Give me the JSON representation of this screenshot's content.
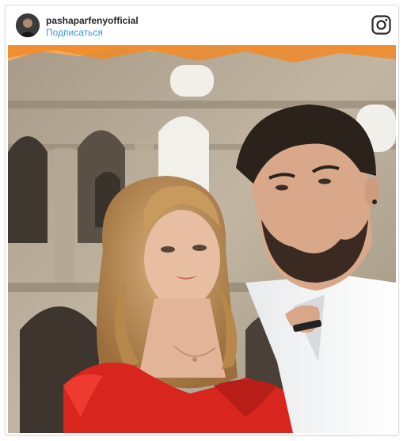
{
  "post": {
    "username": "pashaparfenyofficial",
    "follow_label": "Подписаться"
  },
  "icons": {
    "brand": "instagram-icon",
    "avatar": "avatar"
  },
  "colors": {
    "link": "#3897f0",
    "username": "#262626",
    "border": "#dcdcdc",
    "dress": "#d8261f"
  }
}
